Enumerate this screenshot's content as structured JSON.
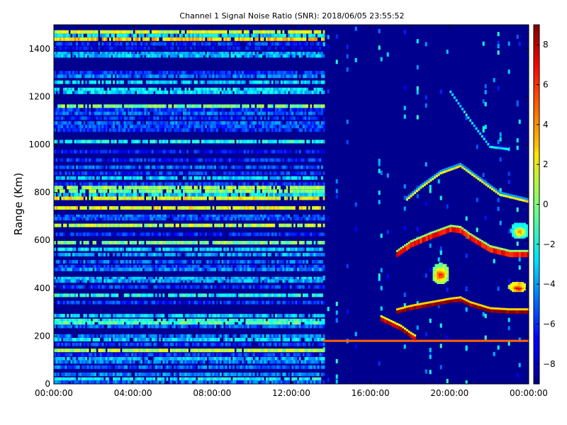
{
  "chart_data": {
    "type": "heatmap",
    "title": "Channel 1 Signal Noise Ratio (SNR): 2018/06/05 23:55:52",
    "xlabel": "",
    "ylabel": "Range (Km)",
    "x_tick_labels": [
      "00:00:00",
      "04:00:00",
      "08:00:00",
      "12:00:00",
      "16:00:00",
      "20:00:00",
      "00:00:00"
    ],
    "x_ticks_hours": [
      0,
      4,
      8,
      12,
      16,
      20,
      24
    ],
    "xlim_hours": [
      0,
      24
    ],
    "y_ticks": [
      0,
      200,
      400,
      600,
      800,
      1000,
      1200,
      1400
    ],
    "ylim": [
      0,
      1500
    ],
    "colorbar": {
      "colormap": "jet",
      "range": [
        -9,
        9
      ],
      "ticks": [
        8,
        6,
        4,
        2,
        0,
        -2,
        -4,
        -6,
        -8
      ],
      "tick_labels": [
        "8",
        "6",
        "4",
        "2",
        "0",
        "−2",
        "−4",
        "−6",
        "−8"
      ]
    },
    "grid": false,
    "background_value": -9,
    "regime_change_hours": 13.6,
    "steady_bands_before_regime": [
      {
        "range_km": 1470,
        "snr": 1.5
      },
      {
        "range_km": 1455,
        "snr": -3
      },
      {
        "range_km": 1440,
        "snr": 3
      },
      {
        "range_km": 1420,
        "snr": -6
      },
      {
        "range_km": 1402,
        "snr": -7
      },
      {
        "range_km": 1380,
        "snr": -4
      },
      {
        "range_km": 1370,
        "snr": -3.5
      },
      {
        "range_km": 1300,
        "snr": -6
      },
      {
        "range_km": 1285,
        "snr": -4.5
      },
      {
        "range_km": 1260,
        "snr": -3
      },
      {
        "range_km": 1230,
        "snr": -2.5
      },
      {
        "range_km": 1218,
        "snr": -3
      },
      {
        "range_km": 1160,
        "snr": 0
      },
      {
        "range_km": 1145,
        "snr": -6
      },
      {
        "range_km": 1130,
        "snr": -5
      },
      {
        "range_km": 1110,
        "snr": -6
      },
      {
        "range_km": 1090,
        "snr": -5
      },
      {
        "range_km": 1075,
        "snr": -5.5
      },
      {
        "range_km": 1060,
        "snr": -6
      },
      {
        "range_km": 1012,
        "snr": -2
      },
      {
        "range_km": 970,
        "snr": -6.5
      },
      {
        "range_km": 935,
        "snr": -6
      },
      {
        "range_km": 905,
        "snr": -5
      },
      {
        "range_km": 880,
        "snr": -6
      },
      {
        "range_km": 860,
        "snr": -3
      },
      {
        "range_km": 835,
        "snr": -6
      },
      {
        "range_km": 820,
        "snr": 0.5
      },
      {
        "range_km": 805,
        "snr": 0
      },
      {
        "range_km": 790,
        "snr": -3
      },
      {
        "range_km": 775,
        "snr": 2
      },
      {
        "range_km": 735,
        "snr": 2
      },
      {
        "range_km": 700,
        "snr": -5
      },
      {
        "range_km": 690,
        "snr": -5.5
      },
      {
        "range_km": 662,
        "snr": 1
      },
      {
        "range_km": 625,
        "snr": -6
      },
      {
        "range_km": 590,
        "snr": 0
      },
      {
        "range_km": 562,
        "snr": -3
      },
      {
        "range_km": 540,
        "snr": -4
      },
      {
        "range_km": 510,
        "snr": -5
      },
      {
        "range_km": 490,
        "snr": -6
      },
      {
        "range_km": 478,
        "snr": -4.5
      },
      {
        "range_km": 440,
        "snr": -3.5
      },
      {
        "range_km": 430,
        "snr": -4
      },
      {
        "range_km": 405,
        "snr": -6
      },
      {
        "range_km": 370,
        "snr": -2
      },
      {
        "range_km": 340,
        "snr": -6
      },
      {
        "range_km": 285,
        "snr": -3
      },
      {
        "range_km": 265,
        "snr": -2
      },
      {
        "range_km": 255,
        "snr": -1
      },
      {
        "range_km": 240,
        "snr": -5
      },
      {
        "range_km": 200,
        "snr": -4.5
      },
      {
        "range_km": 185,
        "snr": -3
      },
      {
        "range_km": 165,
        "snr": -6
      },
      {
        "range_km": 140,
        "snr": 1
      },
      {
        "range_km": 122,
        "snr": -6
      },
      {
        "range_km": 105,
        "snr": -3.5
      },
      {
        "range_km": 92,
        "snr": -4.5
      },
      {
        "range_km": 70,
        "snr": -5
      },
      {
        "range_km": 40,
        "snr": -4.5
      },
      {
        "range_km": 20,
        "snr": -2
      },
      {
        "range_km": 8,
        "snr": -5
      }
    ],
    "features_after_regime": [
      {
        "kind": "horizontal-line",
        "range_km": 180,
        "from_hours": 13.6,
        "to_hours": 24,
        "snr": 5
      },
      {
        "kind": "layer-trace",
        "snr": 6.5,
        "width_km": 22,
        "points": [
          [
            17.3,
            540
          ],
          [
            18,
            580
          ],
          [
            19,
            615
          ],
          [
            20,
            645
          ],
          [
            20.5,
            640
          ],
          [
            21,
            610
          ],
          [
            22,
            560
          ],
          [
            23,
            540
          ],
          [
            24,
            540
          ]
        ]
      },
      {
        "kind": "layer-trace",
        "snr": 9,
        "width_km": 14,
        "points": [
          [
            17.3,
            300
          ],
          [
            18,
            315
          ],
          [
            19,
            330
          ],
          [
            20,
            345
          ],
          [
            20.5,
            350
          ],
          [
            21,
            330
          ],
          [
            22,
            305
          ],
          [
            23,
            300
          ],
          [
            24,
            300
          ]
        ]
      },
      {
        "kind": "layer-trace",
        "snr": 2,
        "width_km": 10,
        "points": [
          [
            17.8,
            770
          ],
          [
            18.5,
            820
          ],
          [
            19.5,
            880
          ],
          [
            20.5,
            910
          ],
          [
            21.5,
            850
          ],
          [
            22.5,
            790
          ],
          [
            24,
            760
          ]
        ]
      },
      {
        "kind": "layer-trace",
        "snr": 8,
        "width_km": 16,
        "points": [
          [
            16.5,
            270
          ],
          [
            17,
            250
          ],
          [
            17.5,
            230
          ],
          [
            18,
            200
          ],
          [
            18.3,
            185
          ]
        ]
      },
      {
        "kind": "blob",
        "center_hours": 19.5,
        "center_range_km": 460,
        "radius_hours": 0.45,
        "radius_km": 40,
        "snr": 7
      },
      {
        "kind": "blob",
        "center_hours": 23.4,
        "center_range_km": 405,
        "radius_hours": 0.45,
        "radius_km": 18,
        "snr": 8.5
      },
      {
        "kind": "blob",
        "center_hours": 23.5,
        "center_range_km": 640,
        "radius_hours": 0.45,
        "radius_km": 30,
        "snr": 5
      },
      {
        "kind": "diagonal-streak",
        "snr": -2,
        "points": [
          [
            20,
            1220
          ],
          [
            21,
            1100
          ],
          [
            22,
            990
          ],
          [
            23,
            980
          ]
        ]
      }
    ]
  }
}
